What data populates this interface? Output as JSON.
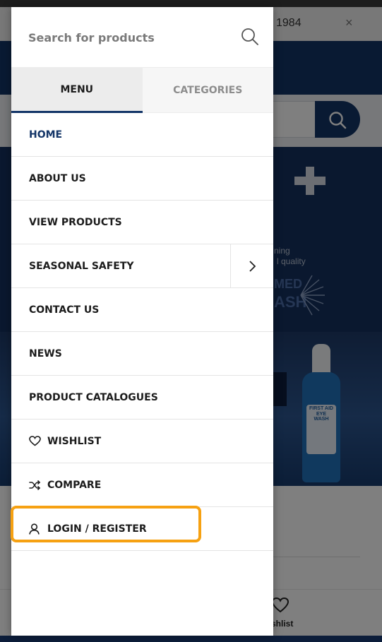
{
  "background": {
    "notice_text": "1984",
    "notice_close": "×",
    "banner_line1": "ning",
    "banner_line2": "l quality",
    "banner_logo_line1": "MED",
    "banner_logo_line2": "ASH",
    "bottle_label": "FIRST AID EYE WASH",
    "bottom_nav_wishlist": "shlist"
  },
  "drawer": {
    "search": {
      "placeholder": "Search for products"
    },
    "tabs": [
      {
        "label": "MENU",
        "active": true
      },
      {
        "label": "CATEGORIES",
        "active": false
      }
    ],
    "menu": {
      "home": "HOME",
      "about": "ABOUT US",
      "view_products": "VIEW PRODUCTS",
      "seasonal_safety": "SEASONAL SAFETY",
      "contact": "CONTACT US",
      "news": "NEWS",
      "catalogues": "PRODUCT CATALOGUES",
      "wishlist": "WISHLIST",
      "compare": "COMPARE",
      "login": "LOGIN / REGISTER"
    }
  },
  "colors": {
    "brand_navy": "#123467",
    "highlight_orange": "#f6a112",
    "overlay": "rgba(0,0,0,0.5)"
  },
  "icons": {
    "search": "search-icon",
    "submenu": "chevron-right-icon",
    "wishlist": "heart-icon",
    "compare": "shuffle-icon",
    "login": "user-icon"
  }
}
